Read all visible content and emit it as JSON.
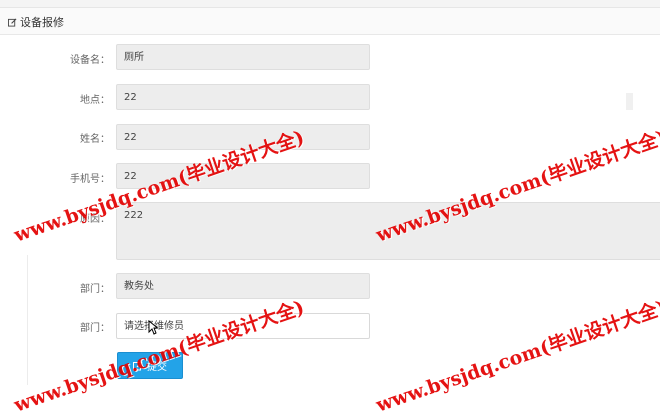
{
  "panel": {
    "title": "设备报修"
  },
  "form": {
    "device_name_label": "设备名：",
    "device_name_value": "厕所",
    "location_label": "地点：",
    "location_value": "22",
    "name_label": "姓名：",
    "name_value": "22",
    "phone_label": "手机号：",
    "phone_value": "22",
    "reason_label": "原因：",
    "reason_value": "222",
    "department_label": "部门：",
    "department_value": "教务处",
    "repairer_label": "部门：",
    "repairer_placeholder": "请选择维修员",
    "submit_label": "提交"
  },
  "watermark": {
    "text": "www.bysjdq.com(毕业设计大全)"
  },
  "colors": {
    "accent": "#23a3e8",
    "watermark": "#e30000"
  },
  "icons": {
    "title_icon": "edit-icon",
    "submit_icon": "edit-icon",
    "cursor": "mouse-cursor-icon"
  }
}
